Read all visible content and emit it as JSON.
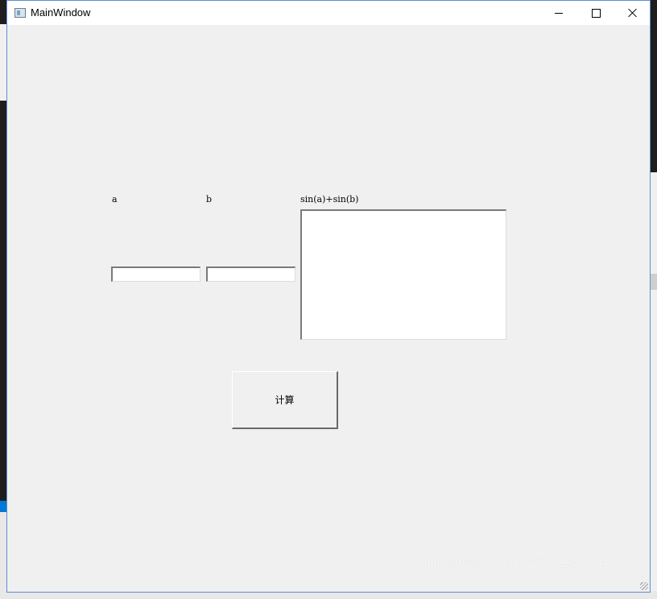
{
  "window": {
    "title": "MainWindow",
    "accent_border": "#5a8fcf",
    "background": "#f0f0f0"
  },
  "titlebar_buttons": {
    "minimize": "minimize-icon",
    "maximize": "maximize-icon",
    "close": "close-icon"
  },
  "form": {
    "label_a": "a",
    "label_b": "b",
    "label_result": "sin(a)+sin(b)",
    "input_a_value": "",
    "input_b_value": "",
    "result_value": "",
    "compute_button": "计算"
  },
  "watermark": "https://blog.csdn.net/weixin_4371011"
}
